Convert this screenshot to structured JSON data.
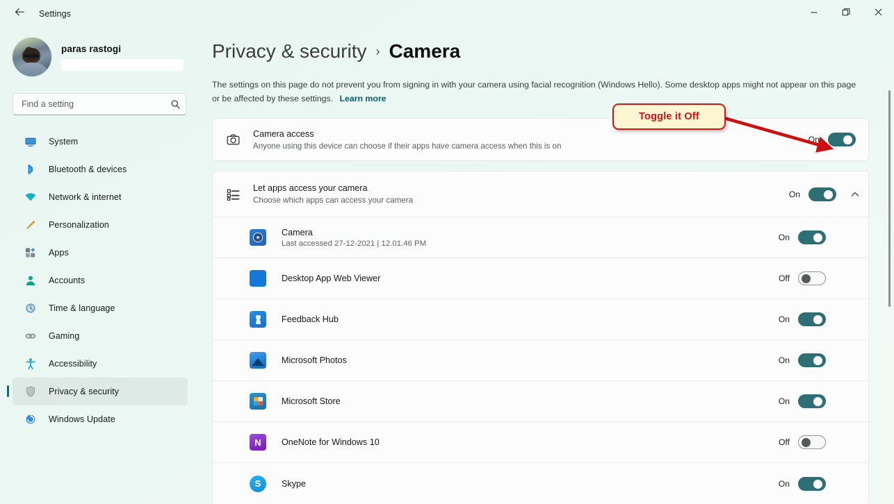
{
  "window": {
    "app_title": "Settings",
    "back_icon": "back-arrow-icon",
    "controls": {
      "minimize": "minimize-icon",
      "restore": "restore-icon",
      "close": "close-icon"
    }
  },
  "sidebar": {
    "profile": {
      "name": "paras rastogi",
      "email_redacted": true
    },
    "search": {
      "placeholder": "Find a setting",
      "value": "",
      "icon": "search-icon"
    },
    "items": [
      {
        "label": "System",
        "icon": "monitor-icon",
        "selected": false
      },
      {
        "label": "Bluetooth & devices",
        "icon": "bluetooth-icon",
        "selected": false
      },
      {
        "label": "Network & internet",
        "icon": "wifi-icon",
        "selected": false
      },
      {
        "label": "Personalization",
        "icon": "paintbrush-icon",
        "selected": false
      },
      {
        "label": "Apps",
        "icon": "apps-grid-icon",
        "selected": false
      },
      {
        "label": "Accounts",
        "icon": "person-icon",
        "selected": false
      },
      {
        "label": "Time & language",
        "icon": "clock-globe-icon",
        "selected": false
      },
      {
        "label": "Gaming",
        "icon": "gamepad-icon",
        "selected": false
      },
      {
        "label": "Accessibility",
        "icon": "accessibility-icon",
        "selected": false
      },
      {
        "label": "Privacy & security",
        "icon": "shield-icon",
        "selected": true
      },
      {
        "label": "Windows Update",
        "icon": "update-arrows-icon",
        "selected": false
      }
    ]
  },
  "page": {
    "breadcrumb_parent": "Privacy & security",
    "breadcrumb_separator": "›",
    "breadcrumb_current": "Camera",
    "description": "The settings on this page do not prevent you from signing in with your camera using facial recognition (Windows Hello). Some desktop apps might not appear on this page or be affected by these settings.",
    "learn_more": "Learn more"
  },
  "camera_access": {
    "icon": "camera-icon",
    "title": "Camera access",
    "subtitle": "Anyone using this device can choose if their apps have camera access when this is on",
    "state_label": "On",
    "state": "on"
  },
  "let_apps": {
    "icon": "list-settings-icon",
    "title": "Let apps access your camera",
    "subtitle": "Choose which apps can access your camera",
    "state_label": "On",
    "state": "on",
    "collapse_icon": "chevron-up-icon"
  },
  "apps": [
    {
      "name": "Camera",
      "sub": "Last accessed 27-12-2021  |  12.01.46 PM",
      "state_label": "On",
      "state": "on",
      "icon": "camera-app-icon",
      "icon_class": "ic-camera",
      "glyph": ""
    },
    {
      "name": "Desktop App Web Viewer",
      "sub": "",
      "state_label": "Off",
      "state": "off",
      "icon": "desktop-app-web-viewer-icon",
      "icon_class": "ic-plain-blue",
      "glyph": ""
    },
    {
      "name": "Feedback Hub",
      "sub": "",
      "state_label": "On",
      "state": "on",
      "icon": "feedback-hub-icon",
      "icon_class": "ic-feedback",
      "glyph": ""
    },
    {
      "name": "Microsoft Photos",
      "sub": "",
      "state_label": "On",
      "state": "on",
      "icon": "microsoft-photos-icon",
      "icon_class": "ic-photos",
      "glyph": ""
    },
    {
      "name": "Microsoft Store",
      "sub": "",
      "state_label": "On",
      "state": "on",
      "icon": "microsoft-store-icon",
      "icon_class": "ic-store",
      "glyph": ""
    },
    {
      "name": "OneNote for Windows 10",
      "sub": "",
      "state_label": "Off",
      "state": "off",
      "icon": "onenote-icon",
      "icon_class": "ic-onenote",
      "glyph": "N"
    },
    {
      "name": "Skype",
      "sub": "",
      "state_label": "On",
      "state": "on",
      "icon": "skype-icon",
      "icon_class": "ic-skype",
      "glyph": "S"
    }
  ],
  "annotation": {
    "text": "Toggle it Off",
    "box_fill": "#fdf6d2",
    "box_border": "#cf1616",
    "text_color": "#cf1010",
    "arrow_color": "#cc1111"
  },
  "colors": {
    "accent_toggle_on": "#2e6f75",
    "selection_bar": "#0f6b72",
    "page_background": "#eaf7f3",
    "card_background": "#fbfcfb",
    "link": "#0b5a66"
  }
}
